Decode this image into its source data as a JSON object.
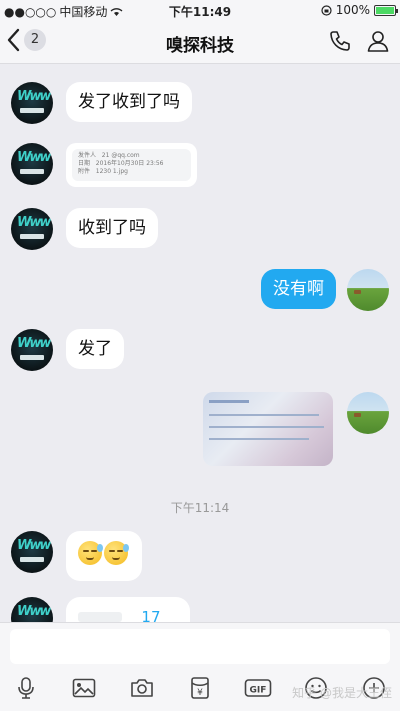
{
  "status": {
    "carrier": "中国移动",
    "time": "下午11:49",
    "battery": "100%"
  },
  "nav": {
    "back_count": "2",
    "title": "嗅探科技"
  },
  "messages": {
    "m1_text": "发了收到了吗",
    "card_line1_label": "发件人",
    "card_line1_value": "21",
    "card_line1_value2": "@qq.com",
    "card_line2_label": "日期",
    "card_line2_value": "2016年10月30日 23:56",
    "card_line3_label": "附件",
    "card_line3_value": "1230 1.jpg",
    "m3_text": "收到了吗",
    "m4_text": "没有啊",
    "m5_text": "发了",
    "timestamp": "下午11:14",
    "last_text": "17"
  },
  "brand": {
    "logo_text": "Www",
    "accent": "#22a9f0"
  },
  "watermark": "知乎 @我是大王侄"
}
